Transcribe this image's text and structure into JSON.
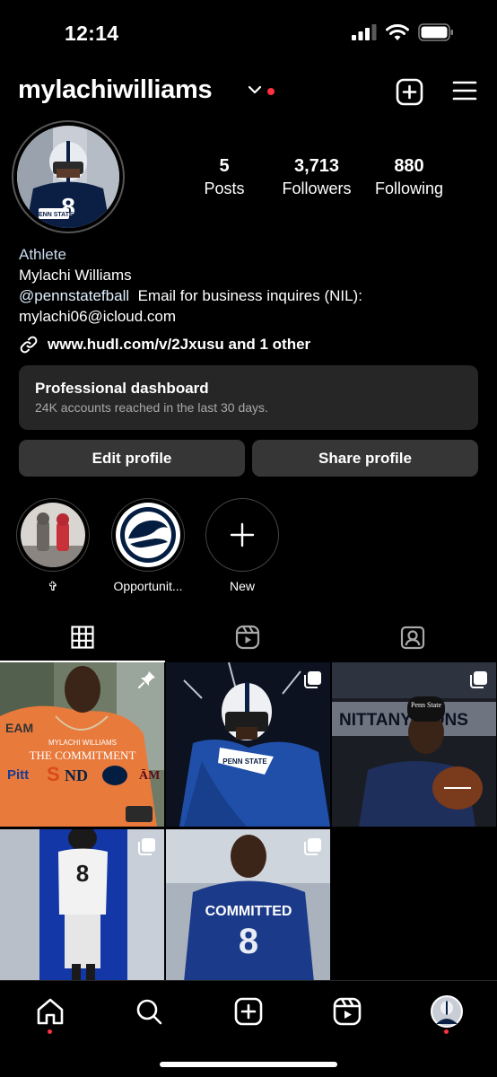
{
  "status_bar": {
    "time": "12:14"
  },
  "header": {
    "username": "mylachiwilliams"
  },
  "profile": {
    "stats": [
      {
        "value": "5",
        "label": "Posts"
      },
      {
        "value": "3,713",
        "label": "Followers"
      },
      {
        "value": "880",
        "label": "Following"
      }
    ],
    "category": "Athlete",
    "name": "Mylachi Williams",
    "mention": "@pennstatefball",
    "bio_line": "Email for business inquires (NIL):",
    "email": "mylachi06@icloud.com",
    "link": "www.hudl.com/v/2Jxusu and 1 other"
  },
  "dashboard": {
    "title": "Professional dashboard",
    "subtitle": "24K accounts reached in the last 30 days."
  },
  "buttons": {
    "edit": "Edit profile",
    "share": "Share profile"
  },
  "highlights": [
    {
      "label": "✞"
    },
    {
      "label": "Opportunit..."
    },
    {
      "label": "New"
    }
  ],
  "posts": [
    {
      "overlay_text_1": "MYLACHI WILLIAMS",
      "overlay_text_2": "THE COMMITMENT"
    },
    {
      "jersey": "PENN STATE"
    },
    {
      "cap": "Penn State",
      "banner": "NITTANY LIONS"
    },
    {
      "jersey": "8"
    },
    {
      "overlay": "COMMITTED"
    }
  ],
  "colors": {
    "accent_red": "#ff3040",
    "card_bg": "#262626",
    "button_bg": "#363636",
    "psu_navy": "#041e42"
  }
}
